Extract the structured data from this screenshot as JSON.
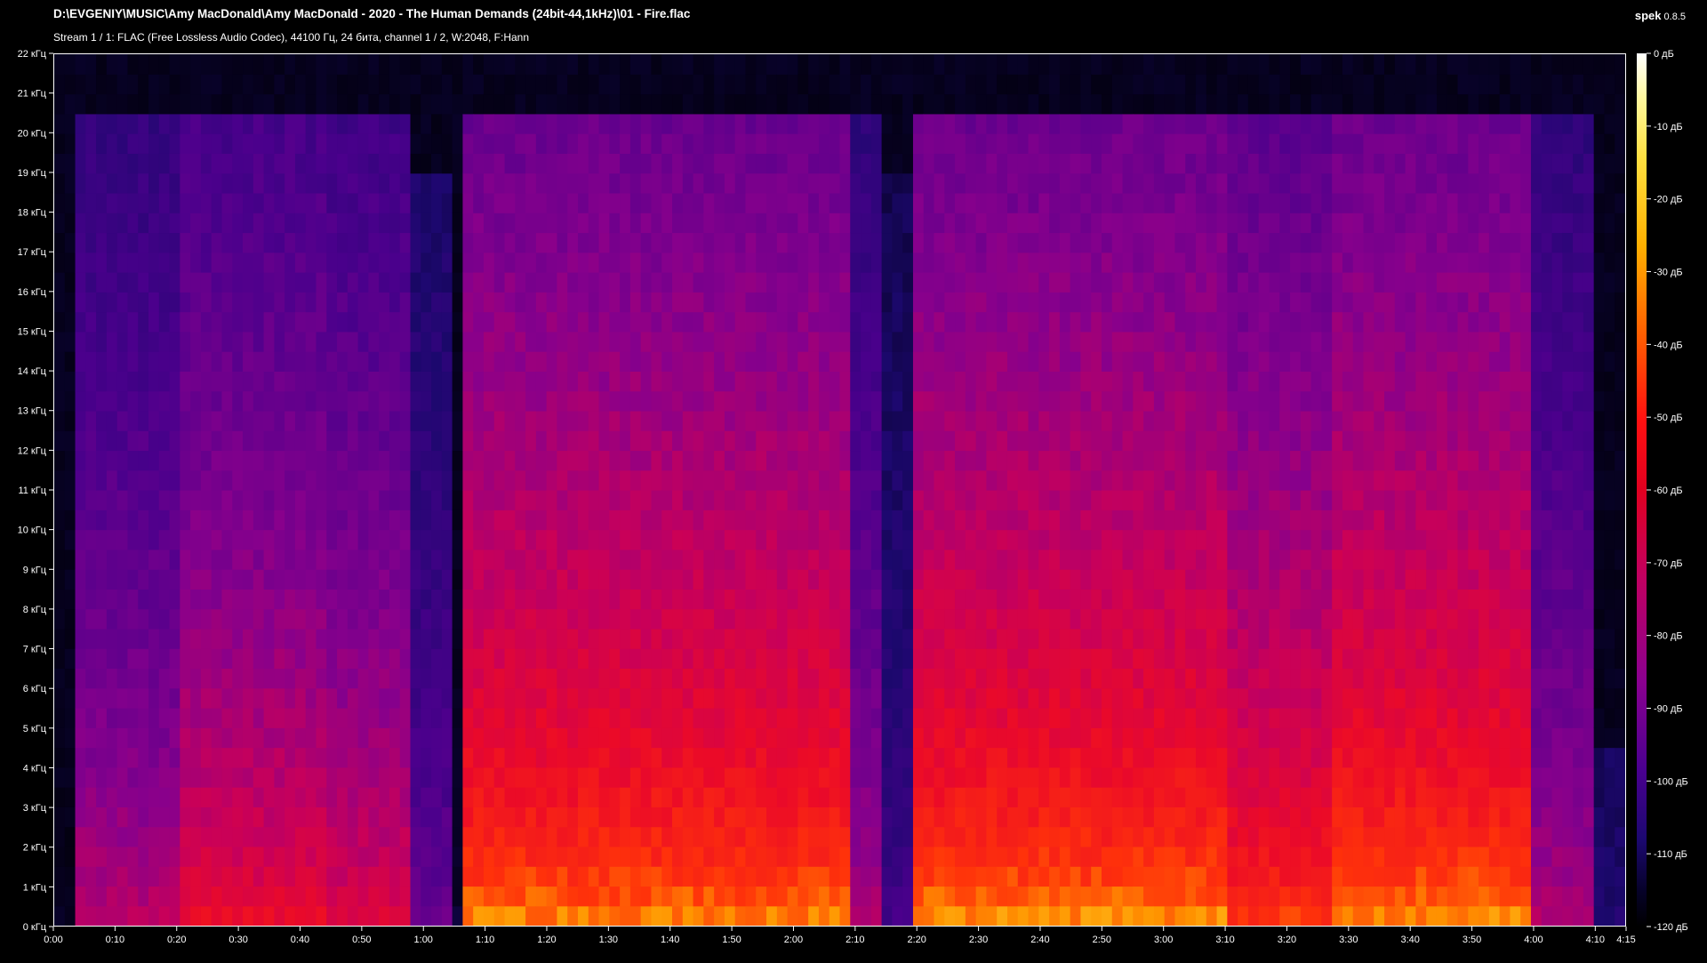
{
  "window": {
    "file_path": "D:\\EVGENIY\\MUSIC\\Amy MacDonald\\Amy MacDonald - 2020 - The Human Demands (24bit-44,1kHz)\\01 - Fire.flac",
    "stream_info": "Stream 1 / 1: FLAC (Free Lossless Audio Codec), 44100 Гц, 24 бита, channel 1 / 2, W:2048, F:Hann",
    "app_name": "spek",
    "app_version": "0.8.5"
  },
  "freq_axis": {
    "max_khz": 22,
    "labels": [
      "0 кГц",
      "1 кГц",
      "2 кГц",
      "3 кГц",
      "4 кГц",
      "5 кГц",
      "6 кГц",
      "7 кГц",
      "8 кГц",
      "9 кГц",
      "10 кГц",
      "11 кГц",
      "12 кГц",
      "13 кГц",
      "14 кГц",
      "15 кГц",
      "16 кГц",
      "17 кГц",
      "18 кГц",
      "19 кГц",
      "20 кГц",
      "21 кГц",
      "22 кГц"
    ]
  },
  "time_axis": {
    "duration_sec": 255,
    "ticks": [
      {
        "sec": 0,
        "label": "0:00"
      },
      {
        "sec": 10,
        "label": "0:10"
      },
      {
        "sec": 20,
        "label": "0:20"
      },
      {
        "sec": 30,
        "label": "0:30"
      },
      {
        "sec": 40,
        "label": "0:40"
      },
      {
        "sec": 50,
        "label": "0:50"
      },
      {
        "sec": 60,
        "label": "1:00"
      },
      {
        "sec": 70,
        "label": "1:10"
      },
      {
        "sec": 80,
        "label": "1:20"
      },
      {
        "sec": 90,
        "label": "1:30"
      },
      {
        "sec": 100,
        "label": "1:40"
      },
      {
        "sec": 110,
        "label": "1:50"
      },
      {
        "sec": 120,
        "label": "2:00"
      },
      {
        "sec": 130,
        "label": "2:10"
      },
      {
        "sec": 140,
        "label": "2:20"
      },
      {
        "sec": 150,
        "label": "2:30"
      },
      {
        "sec": 160,
        "label": "2:40"
      },
      {
        "sec": 170,
        "label": "2:50"
      },
      {
        "sec": 180,
        "label": "3:00"
      },
      {
        "sec": 190,
        "label": "3:10"
      },
      {
        "sec": 200,
        "label": "3:20"
      },
      {
        "sec": 210,
        "label": "3:30"
      },
      {
        "sec": 220,
        "label": "3:40"
      },
      {
        "sec": 230,
        "label": "3:50"
      },
      {
        "sec": 240,
        "label": "4:00"
      },
      {
        "sec": 250,
        "label": "4:10"
      },
      {
        "sec": 255,
        "label": "4:15"
      }
    ]
  },
  "db_scale": {
    "min_db": -120,
    "max_db": 0,
    "labels": [
      "0 дБ",
      "-10 дБ",
      "-20 дБ",
      "-30 дБ",
      "-40 дБ",
      "-50 дБ",
      "-60 дБ",
      "-70 дБ",
      "-80 дБ",
      "-90 дБ",
      "-100 дБ",
      "-110 дБ",
      "-120 дБ"
    ]
  },
  "colors": {
    "background": "#000000",
    "frame": "#ffffff",
    "text": "#ffffff"
  }
}
